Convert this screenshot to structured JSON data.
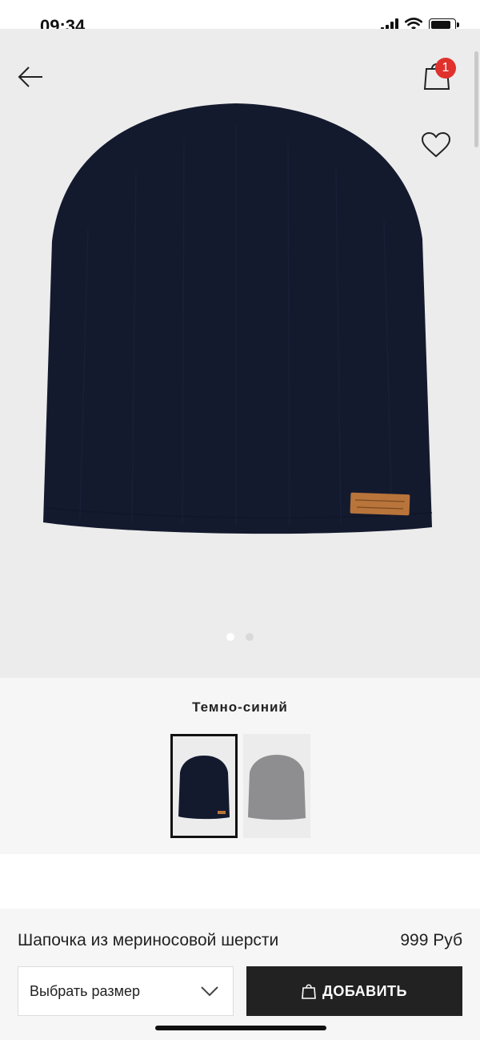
{
  "status_bar": {
    "time": "09:34",
    "battery_level": 0.85
  },
  "header": {
    "cart_count": "1"
  },
  "gallery": {
    "image_count": 2,
    "active_index": 0
  },
  "color": {
    "selected_label": "Темно-синий",
    "swatches": [
      {
        "name": "navy",
        "color": "#141a2e",
        "selected": true
      },
      {
        "name": "grey",
        "color": "#8e8e90",
        "selected": false
      }
    ]
  },
  "product": {
    "name": "Шапочка из мериносовой шерсти",
    "price": "999 Руб"
  },
  "actions": {
    "size_select_label": "Выбрать размер",
    "add_button_label": "ДОБАВИТЬ"
  },
  "colors": {
    "hat_navy": "#141a2e",
    "hat_grey": "#8e8e90",
    "badge_red": "#e0312c",
    "label_tan": "#b8743a"
  }
}
